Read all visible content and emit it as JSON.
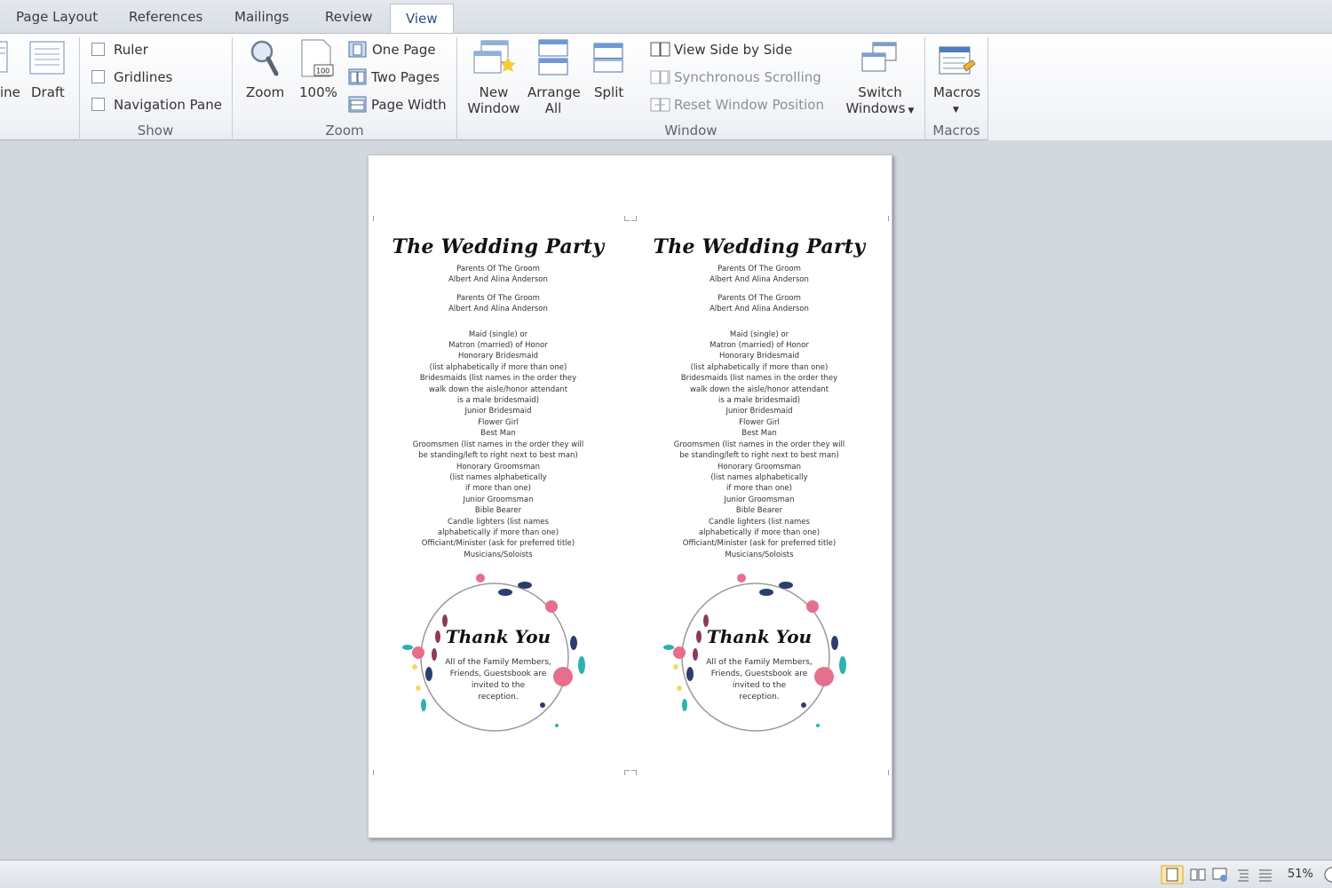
{
  "tabs": [
    {
      "label": "Page Layout"
    },
    {
      "label": "References"
    },
    {
      "label": "Mailings"
    },
    {
      "label": "Review"
    },
    {
      "label": "View"
    }
  ],
  "ribbon": {
    "views": {
      "outline_partial": "ine",
      "draft": "Draft"
    },
    "show": {
      "group": "Show",
      "ruler": "Ruler",
      "gridlines": "Gridlines",
      "navigation_pane": "Navigation Pane"
    },
    "zoom": {
      "group": "Zoom",
      "zoom": "Zoom",
      "hundred": "100%",
      "icon_text": "100",
      "one_page": "One Page",
      "two_pages": "Two Pages",
      "page_width": "Page Width"
    },
    "window": {
      "group": "Window",
      "new_window_1": "New",
      "new_window_2": "Window",
      "arrange_all_1": "Arrange",
      "arrange_all_2": "All",
      "split": "Split",
      "view_side_by_side": "View Side by Side",
      "synchronous_scrolling": "Synchronous Scrolling",
      "reset_window_position": "Reset Window Position",
      "switch_windows_1": "Switch",
      "switch_windows_2": "Windows"
    },
    "macros": {
      "group": "Macros",
      "macros": "Macros"
    }
  },
  "document": {
    "title": "The Wedding Party",
    "lines": [
      "Parents Of The Groom",
      "Albert And Alina Anderson",
      "",
      "Parents Of The Groom",
      "Albert And Alina Anderson",
      "",
      "",
      "Maid (single) or",
      "Matron (married) of Honor",
      "Honorary Bridesmaid",
      "(list alphabetically if more than one)",
      "Bridesmaids (list names in the order they",
      "walk down the aisle/honor attendant",
      "is a male bridesmaid)",
      "Junior Bridesmaid",
      "Flower Girl",
      "Best Man",
      "Groomsmen (list names in the order they will",
      "be standing/left to right next to best man)",
      "Honorary Groomsman",
      "(list names alphabetically",
      "if more than one)",
      "Junior Groomsman",
      "Bible Bearer",
      "Candle lighters (list names",
      "alphabetically if more than one)",
      "Officiant/Minister (ask for preferred title)",
      "Musicians/Soloists"
    ],
    "thank_you": "Thank You",
    "thank_lines": [
      "All of the Family Members,",
      "Friends, Guestsbook are",
      "invited to the",
      "reception."
    ]
  },
  "status": {
    "zoom_level": "51%"
  },
  "colors": {
    "accent": "#2b579a",
    "background": "#d3d8df",
    "flower_pink": "#e76f8e",
    "flower_navy": "#2c3e6b",
    "flower_teal": "#2bb3b1"
  }
}
